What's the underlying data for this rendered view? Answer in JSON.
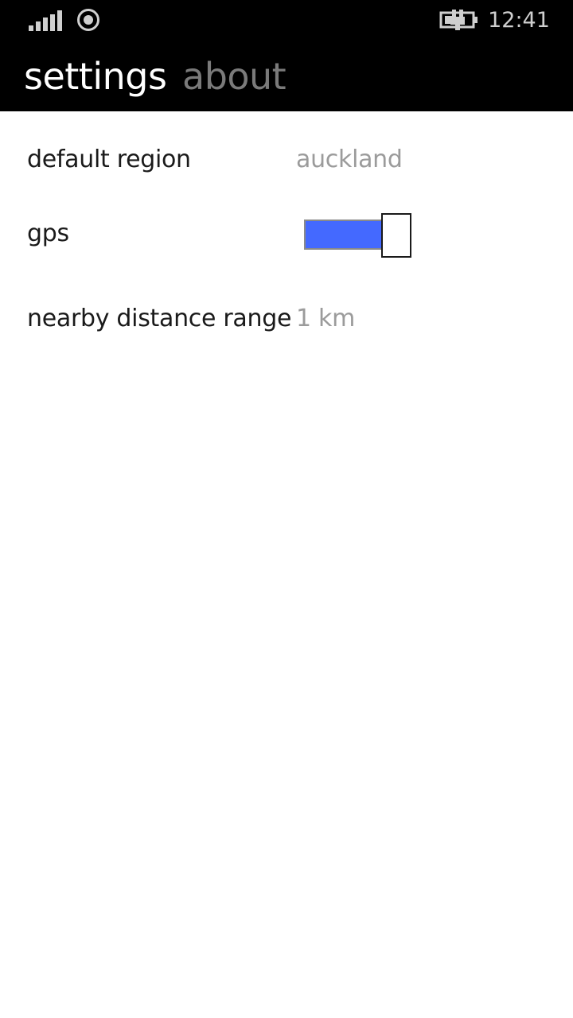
{
  "status_bar": {
    "time": "12:41",
    "icons": [
      "signal-strength-icon",
      "location-icon",
      "battery-charging-icon"
    ]
  },
  "pivot": {
    "tabs": [
      {
        "label": "settings",
        "active": true
      },
      {
        "label": "about",
        "active": false
      }
    ]
  },
  "settings": {
    "default_region": {
      "label": "default region",
      "value": "auckland"
    },
    "gps": {
      "label": "gps",
      "enabled": true
    },
    "nearby_distance": {
      "label": "nearby distance range",
      "value": "1 km"
    }
  },
  "colors": {
    "header_bg": "#000000",
    "tab_active": "#ffffff",
    "tab_inactive": "#7a7a7a",
    "label_text": "#1a1a1a",
    "value_text": "#9b9b9b",
    "toggle_fill": "#4469ff"
  }
}
